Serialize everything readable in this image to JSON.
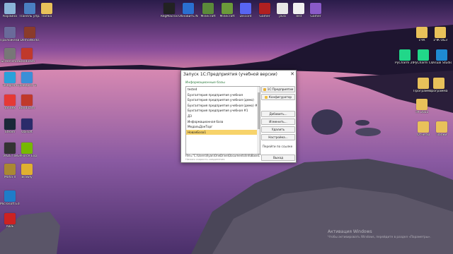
{
  "desktop": {
    "icons_left": [
      {
        "label": "Корзина",
        "color": "#8ab4d8"
      },
      {
        "label": "Панель управления",
        "color": "#4a7fc1"
      },
      {
        "label": "Папка",
        "color": "#e8c15a"
      },
      {
        "label": "Приложения",
        "color": "#6a6a9a"
      },
      {
        "label": "DemoWorks",
        "color": "#8a3b2b"
      },
      {
        "label": "Screenshot",
        "color": "#777777"
      },
      {
        "label": "Bandicam",
        "color": "#c0392b"
      },
      {
        "label": "Telegram",
        "color": "#2aa1da"
      },
      {
        "label": "Проверка Telegram",
        "color": "#3a8fd8"
      },
      {
        "label": "Yandex",
        "color": "#e53935"
      },
      {
        "label": "Bandicam",
        "color": "#c0392b"
      },
      {
        "label": "Steam",
        "color": "#1b2838"
      },
      {
        "label": "Ubisoft",
        "color": "#2b2b6a"
      },
      {
        "label": "VAZE Ли",
        "color": "#333333"
      },
      {
        "label": "GeForce Experience",
        "color": "#76b900"
      },
      {
        "label": "Mafia II",
        "color": "#aa8833"
      },
      {
        "label": "Brawly",
        "color": "#e0b030"
      },
      {
        "label": "Microsoft Edge",
        "color": "#1f7cc8"
      },
      {
        "label": "AIDE",
        "color": "#cc2222"
      }
    ],
    "icons_top": [
      {
        "label": "RegMacros",
        "color": "#222222"
      },
      {
        "label": "Обновить Nemu",
        "color": "#2a6fd0"
      },
      {
        "label": "Minecraft",
        "color": "#5b8a3a"
      },
      {
        "label": "Minecraft",
        "color": "#6b9a3a"
      },
      {
        "label": "Discord",
        "color": "#5865f2"
      },
      {
        "label": "Gamer",
        "color": "#b02020"
      },
      {
        "label": "java",
        "color": "#e8e8e8"
      },
      {
        "label": "Test",
        "color": "#f0f0f0"
      },
      {
        "label": "Gamer",
        "color": "#8a5ac8"
      }
    ],
    "icons_right": [
      {
        "label": "1ЧК",
        "color": "#e8c15a"
      },
      {
        "label": "1ЧК ОБЗ",
        "color": "#e8c15a"
      },
      {
        "label": "PyCharm 2023.2",
        "color": "#21d789"
      },
      {
        "label": "PyCharm Communi...",
        "color": "#21d789"
      },
      {
        "label": "Visual Studio Code",
        "color": "#1f8ad2"
      },
      {
        "label": "Программа решения ИД",
        "color": "#e8c15a"
      },
      {
        "label": "Программа для ВКТ",
        "color": "#e8c15a"
      },
      {
        "label": "ТК 2023",
        "color": "#e8c15a"
      },
      {
        "label": "Отчеты",
        "color": "#e8c15a"
      },
      {
        "label": "Папки",
        "color": "#e8c15a"
      }
    ]
  },
  "dialog": {
    "title": "Запуск 1С:Предприятия (учебной версии)",
    "close_label": "✕",
    "list_header": "Информационные базы",
    "bases": [
      "tested",
      "Бухгалтерия предприятия учебная",
      "Бухгалтерия предприятия учебная (демо)",
      "Бухгалтерия предприятия учебная (демо) #1",
      "Бухгалтерия предприятия учебная #1",
      "ДЗ",
      "Информационная база",
      "МедальДонТорг",
      "НоваяБаза1"
    ],
    "selected_index": 8,
    "path": "File=\"C:\\Users\\Ilyan\\OneDrive\\Documents\\InfoBase1\"",
    "mode": "Низкая скорость соединения",
    "buttons": {
      "enterprise": "1С:Предприятие",
      "configurator": "Конфигуратор",
      "add": "Добавить...",
      "edit": "Изменить...",
      "delete": "Удалить",
      "settings": "Настройка...",
      "web": "Перейти по ссылке",
      "exit": "Выход"
    }
  },
  "watermark": {
    "line1": "Активация Windows",
    "line2": "Чтобы активировать Windows, перейдите в раздел «Параметры»."
  },
  "colors": {
    "selection": "#f7d36b",
    "enterprise_icon": "#e8b23a",
    "configurator_icon": "#f0c040"
  }
}
